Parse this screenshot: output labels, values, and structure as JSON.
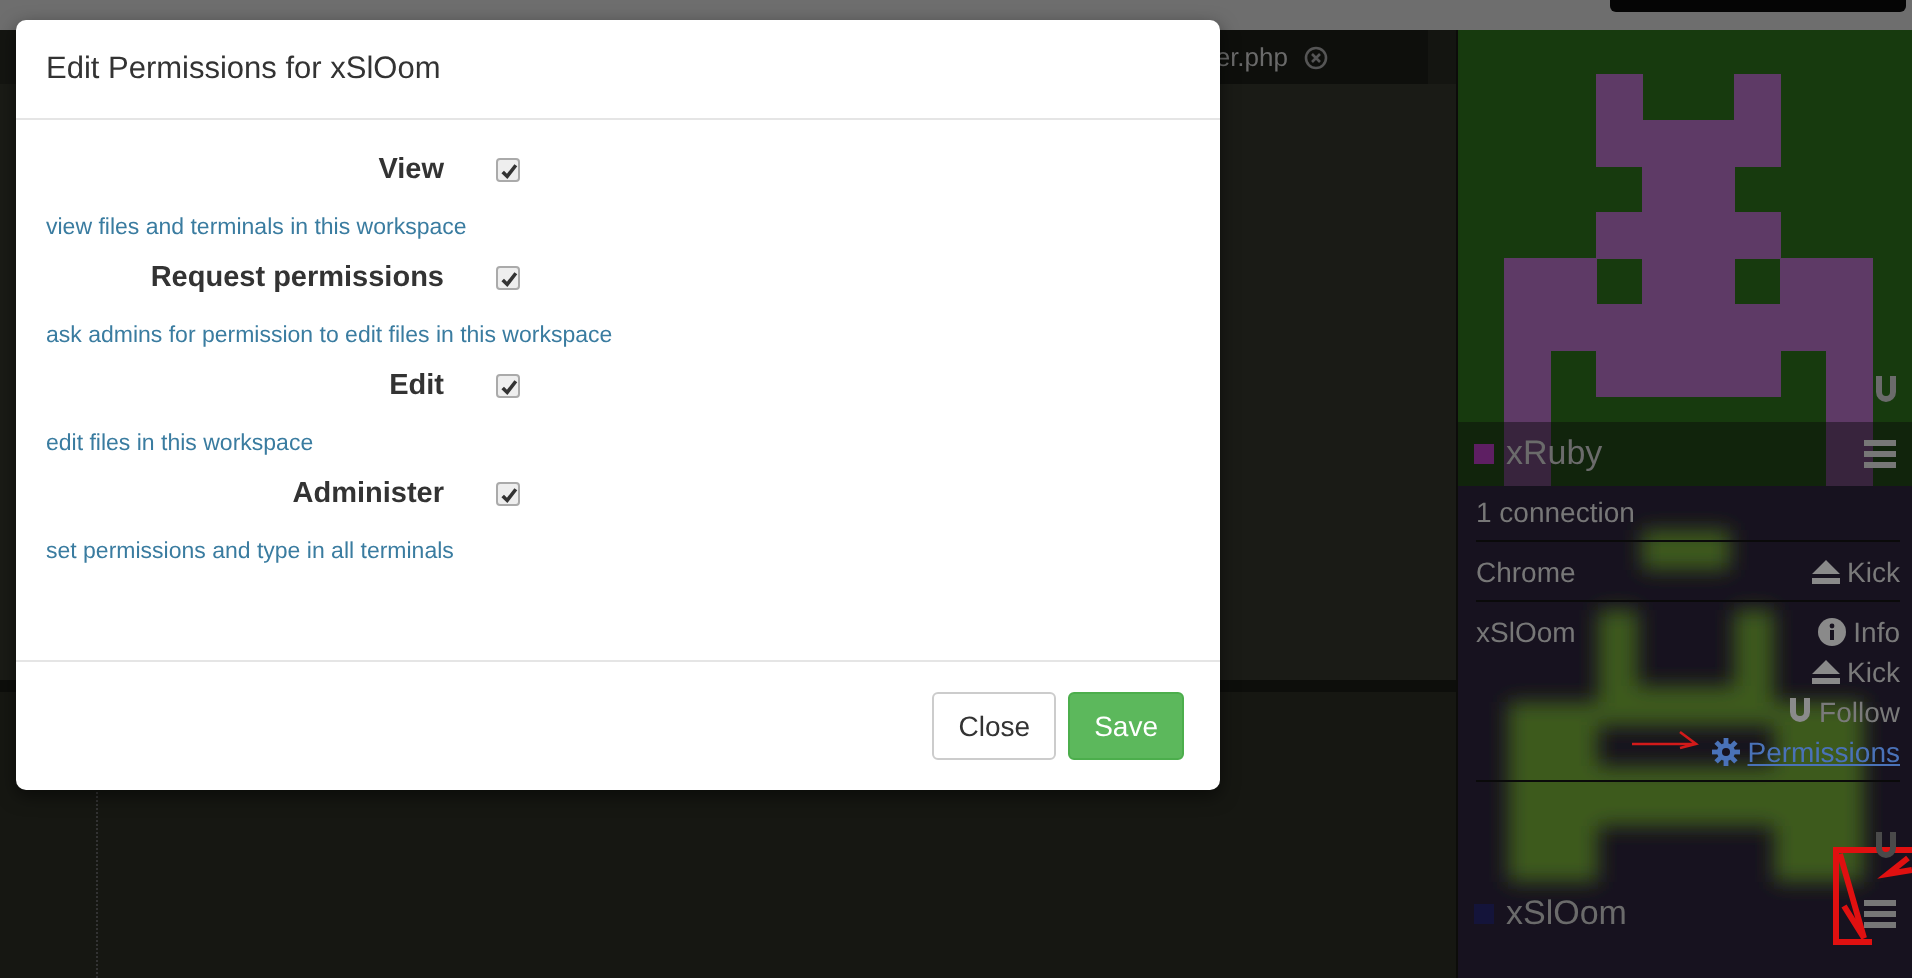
{
  "editor_tab": {
    "label": "er.php"
  },
  "dialog": {
    "title": "Edit Permissions for xSlOom",
    "permissions": [
      {
        "label": "View",
        "checked": true,
        "description": "view files and terminals in this workspace"
      },
      {
        "label": "Request permissions",
        "checked": true,
        "description": "ask admins for permission to edit files in this workspace"
      },
      {
        "label": "Edit",
        "checked": true,
        "description": "edit files in this workspace"
      },
      {
        "label": "Administer",
        "checked": true,
        "description": "set permissions and type in all terminals"
      }
    ],
    "buttons": [
      {
        "label": "Close",
        "kind": "default"
      },
      {
        "label": "Save",
        "kind": "primary"
      }
    ]
  },
  "users": [
    {
      "name": "xRuby",
      "color": "#5e1f63",
      "connection_count": "1 connection",
      "clients": [
        {
          "name": "Chrome",
          "actions": [
            {
              "kind": "kick",
              "label": "Kick"
            }
          ]
        },
        {
          "name": "xSlOom",
          "actions": [
            {
              "kind": "info",
              "label": "Info"
            },
            {
              "kind": "kick",
              "label": "Kick"
            },
            {
              "kind": "follow",
              "label": "Follow"
            },
            {
              "kind": "permissions",
              "label": "Permissions"
            }
          ]
        }
      ]
    },
    {
      "name": "xSlOom",
      "color": "#14143a"
    }
  ]
}
